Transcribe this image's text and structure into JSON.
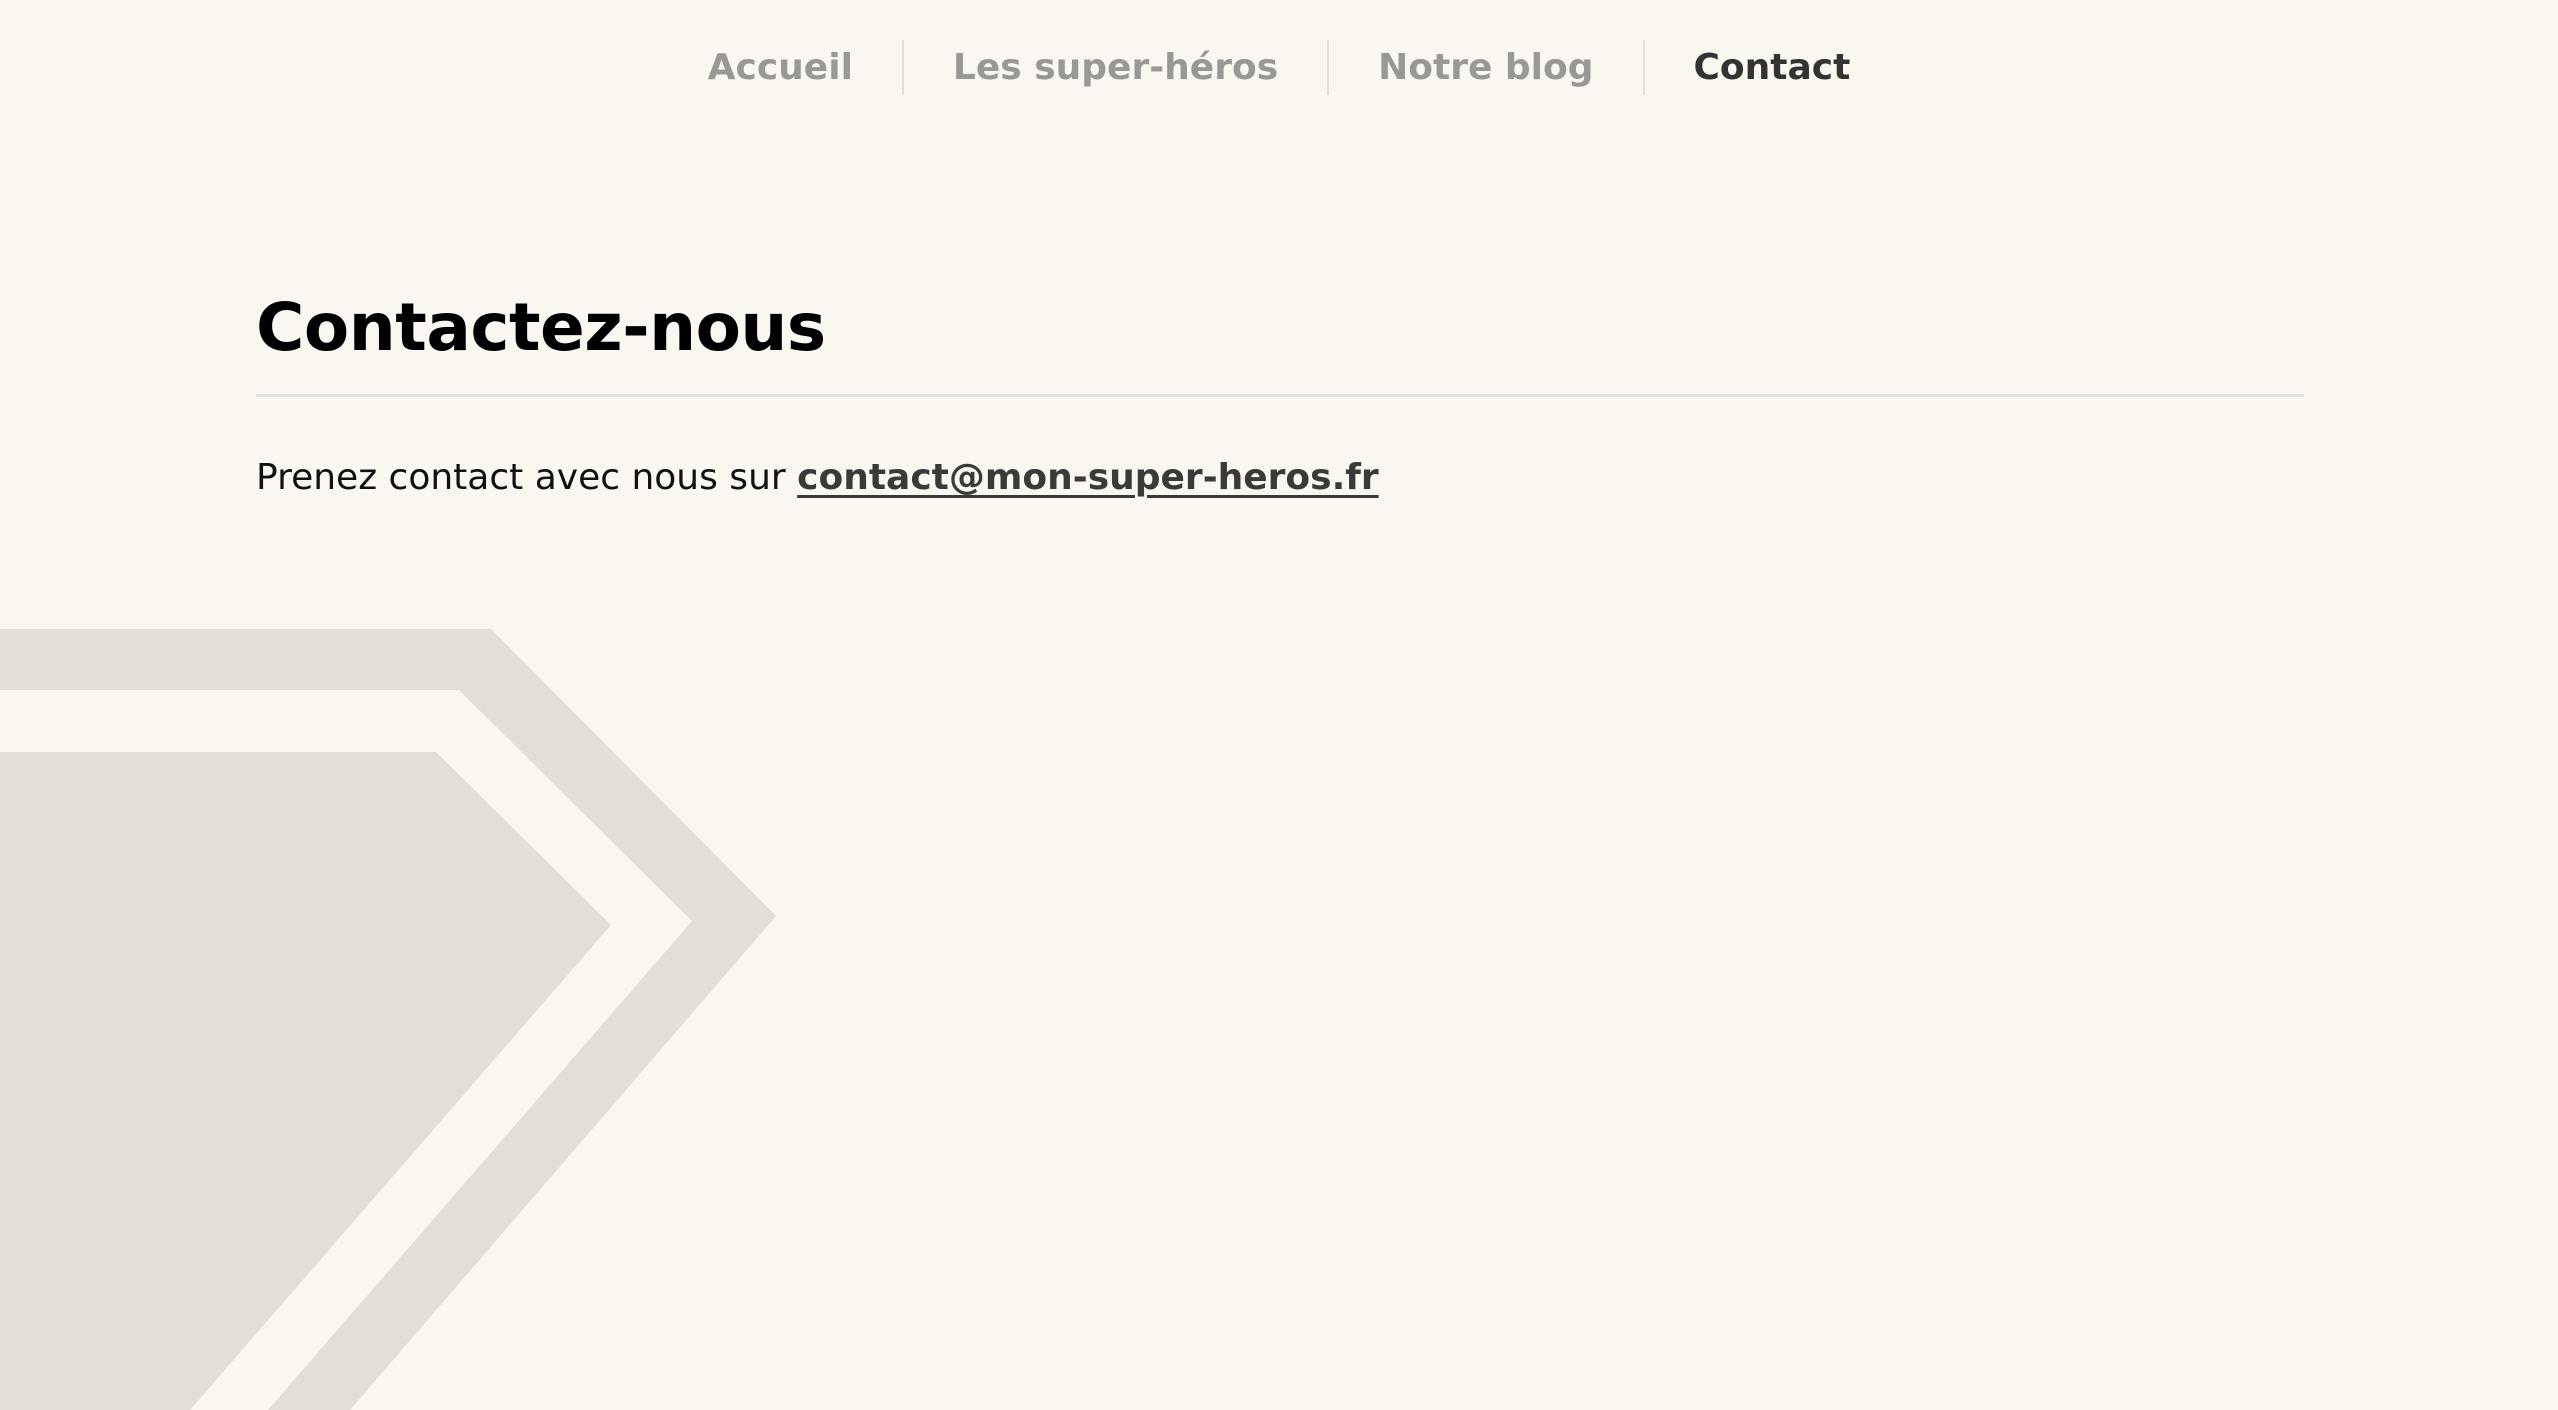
{
  "nav": {
    "items": [
      {
        "label": "Accueil",
        "active": false
      },
      {
        "label": "Les super-héros",
        "active": false
      },
      {
        "label": "Notre blog",
        "active": false
      },
      {
        "label": "Contact",
        "active": true
      }
    ]
  },
  "main": {
    "title": "Contactez-nous",
    "text_prefix": "Prenez contact avec nous sur ",
    "email": "contact@mon-super-heros.fr"
  },
  "colors": {
    "background": "#faf6f0",
    "decoration": "#e2dfd8",
    "nav_inactive": "#9a9895",
    "nav_active": "#333333",
    "divider": "#e3e1dc"
  },
  "icons": [
    "diamond-logo-decoration"
  ]
}
